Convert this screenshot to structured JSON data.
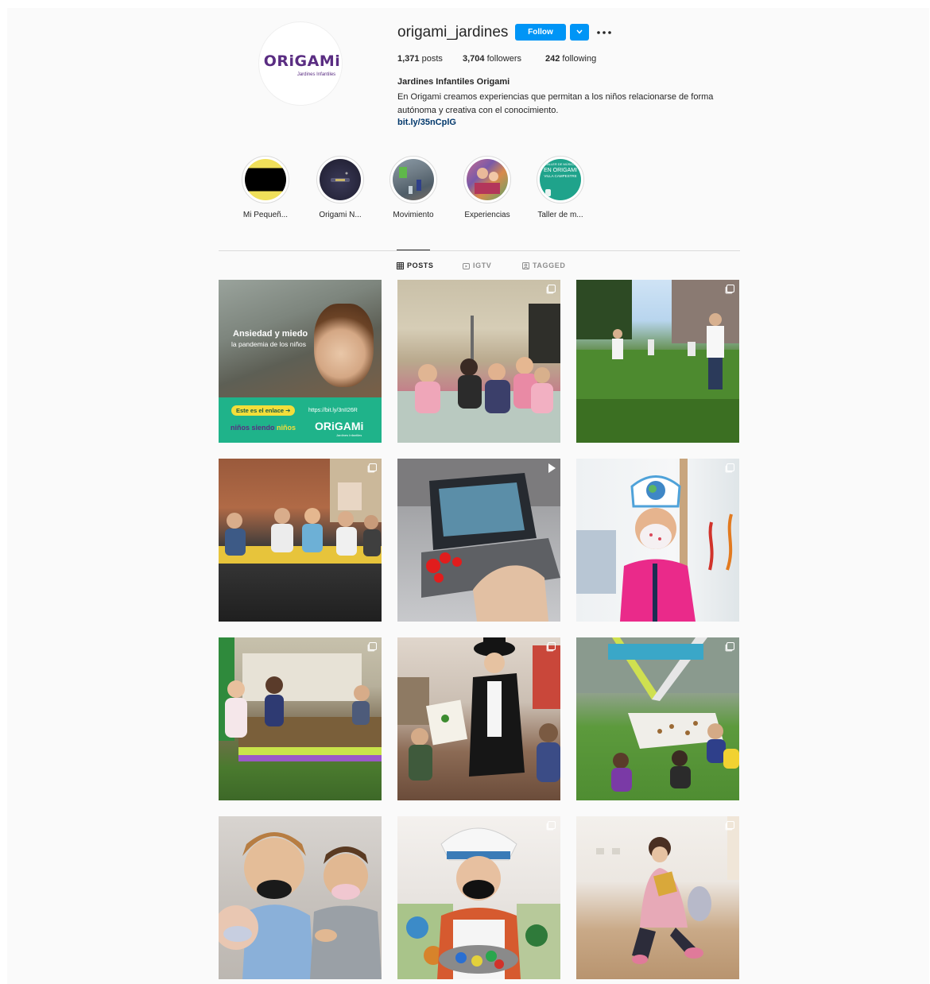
{
  "profile": {
    "logo_word_a": "ORiGA",
    "logo_word_b": "Mi",
    "logo_sub": "Jardines Infantiles",
    "username": "origami_jardines",
    "follow_label": "Follow",
    "stats": {
      "posts_count": "1,371",
      "posts_label": "posts",
      "followers_count": "3,704",
      "followers_label": "followers",
      "following_count": "242",
      "following_label": "following"
    },
    "bio_name": "Jardines Infantiles Origami",
    "bio_text": "En Origami creamos experiencias que permitan a los niños relacionarse de forma autónoma y creativa con el conocimiento.",
    "bio_link": "bit.ly/35nCplG"
  },
  "highlights": [
    {
      "label": "Mi Pequeñ..."
    },
    {
      "label": "Origami N..."
    },
    {
      "label": "Movimiento"
    },
    {
      "label": "Experiencias"
    },
    {
      "label": "Taller de m...",
      "cover_text": [
        "TALLER DE MÚSICA",
        "EN ORIGAMI",
        "VILLA CAMPESTRE"
      ]
    }
  ],
  "tabs": [
    {
      "label": "POSTS",
      "active": true
    },
    {
      "label": "IGTV",
      "active": false
    },
    {
      "label": "TAGGED",
      "active": false
    }
  ],
  "first_post": {
    "title": "Ansiedad y miedo",
    "subtitle": "la pandemia de los niños",
    "cta": "Este es el enlace ➔",
    "url": "https://bit.ly/3nII26R",
    "tagline_a": "niños siendo",
    "tagline_b": "niños",
    "brand": "ORiGAMi",
    "brand_sub": "Jardines Infantiles"
  },
  "colors": {
    "follow_blue": "#0095f6",
    "link_blue": "#00376b",
    "brand_purple": "#5a2d82",
    "post_green": "#1fb38a"
  },
  "icons": [
    "chevron-down-icon",
    "more-options-icon",
    "grid-icon",
    "igtv-icon",
    "tagged-icon",
    "multiple-photos-icon",
    "video-icon"
  ]
}
